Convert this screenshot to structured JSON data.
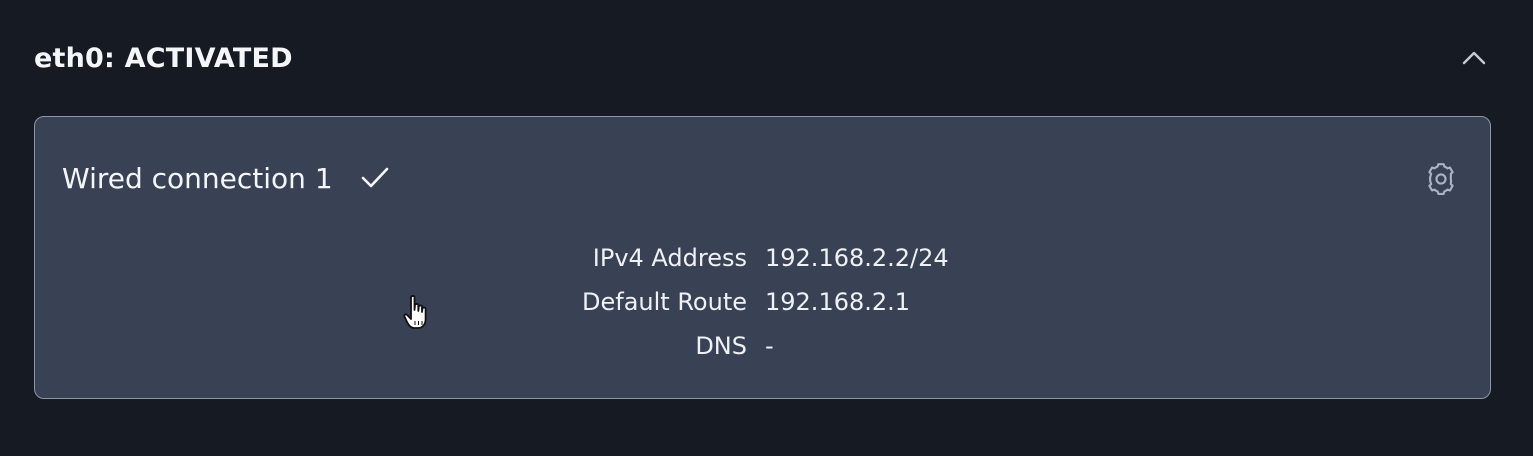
{
  "section": {
    "title": "eth0: ACTIVATED",
    "collapse_icon": "chevron-up-icon"
  },
  "connection": {
    "name": "Wired connection 1",
    "status_icon": "check-icon",
    "settings_icon": "gear-icon",
    "details": [
      {
        "label": "IPv4 Address",
        "value": "192.168.2.2/24"
      },
      {
        "label": "Default Route",
        "value": "192.168.2.1"
      },
      {
        "label": "DNS",
        "value": "-"
      }
    ]
  },
  "colors": {
    "background": "#161a23",
    "card_background": "#394255",
    "card_border": "#8d96a7",
    "text": "#f4f6fa",
    "icon": "#aab3c3"
  }
}
